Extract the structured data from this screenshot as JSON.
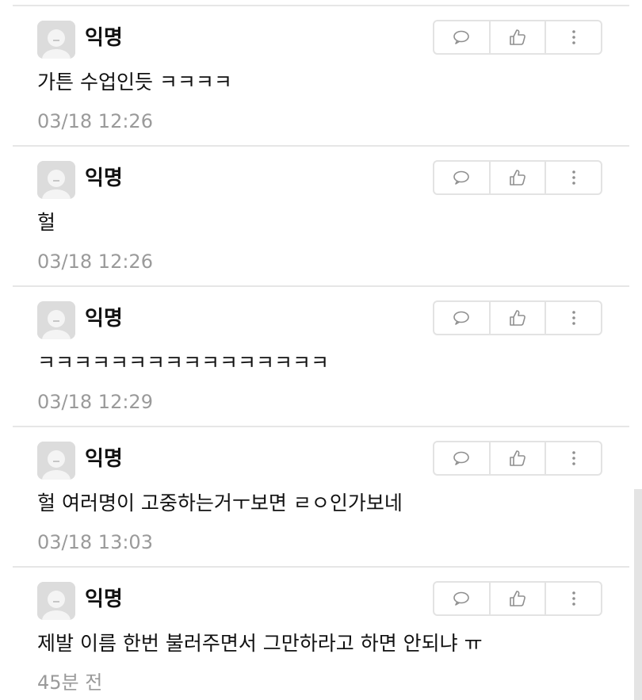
{
  "comments": [
    {
      "author": "익명",
      "text": "가튼 수업인듯 ㅋㅋㅋㅋ",
      "time": "03/18 12:26"
    },
    {
      "author": "익명",
      "text": "헐",
      "time": "03/18 12:26"
    },
    {
      "author": "익명",
      "text": "ㅋㅋㅋㅋㅋㅋㅋㅋㅋㅋㅋㅋㅋㅋㅋㅋ",
      "time": "03/18 12:29"
    },
    {
      "author": "익명",
      "text": "헐 여러명이 고중하는거ㅜ보면 ㄹㅇ인가보네",
      "time": "03/18 13:03"
    },
    {
      "author": "익명",
      "text": "제발 이름 한번 불러주면서 그만하라고 하면 안되냐 ㅠ",
      "time": "45분 전"
    }
  ],
  "icons": {
    "avatar": "avatar-placeholder-icon",
    "reply": "speech-bubble-icon",
    "like": "thumbs-up-icon",
    "more": "more-vertical-icon"
  },
  "colors": {
    "divider": "#e6e6e6",
    "timestamp": "#9a9a9a",
    "icon": "#8f8f8f",
    "avatar_bg": "#dcdcdc"
  }
}
